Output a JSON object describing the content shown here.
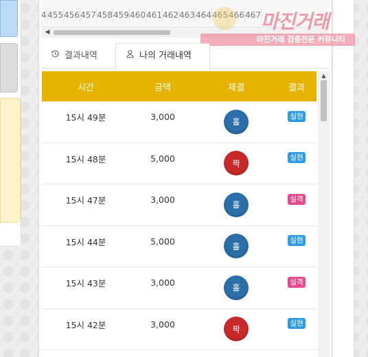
{
  "number_strip": [
    "4",
    "455",
    "456",
    "457",
    "458",
    "459",
    "460",
    "461",
    "462",
    "463",
    "464",
    "465",
    "466",
    "467"
  ],
  "watermark": {
    "logo": "마진거래",
    "tagline": "마진거래 검증전문 커뮤니티"
  },
  "tabs": [
    {
      "label": "결과내역",
      "icon": "history-icon",
      "active": false
    },
    {
      "label": "나의 거래내역",
      "icon": "user-icon",
      "active": true
    }
  ],
  "table": {
    "headers": [
      "시간",
      "금액",
      "체결",
      "결과"
    ],
    "rows": [
      {
        "time": "15시 49분",
        "amount": "3,000",
        "pick": "홀",
        "result": "실현"
      },
      {
        "time": "15시 48분",
        "amount": "5,000",
        "pick": "짝",
        "result": "실현"
      },
      {
        "time": "15시 47분",
        "amount": "3,000",
        "pick": "홀",
        "result": "실격"
      },
      {
        "time": "15시 44분",
        "amount": "5,000",
        "pick": "홀",
        "result": "실현"
      },
      {
        "time": "15시 43분",
        "amount": "3,000",
        "pick": "홀",
        "result": "실격"
      },
      {
        "time": "15시 42분",
        "amount": "3,000",
        "pick": "짝",
        "result": "실현"
      }
    ]
  },
  "colors": {
    "header_bg": "#e6b400",
    "odd_ball": "#2b6ea8",
    "even_ball": "#c8292b",
    "result_win": "#2d9be6",
    "result_lose": "#e8488c"
  }
}
